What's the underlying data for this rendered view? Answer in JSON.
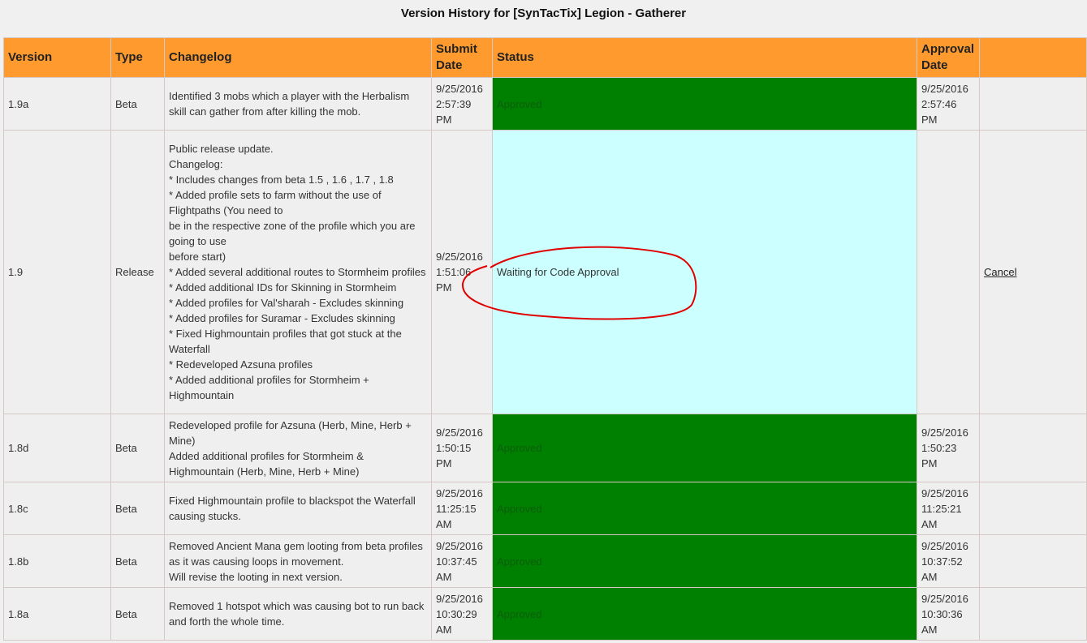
{
  "page": {
    "title": "Version History for [SynTacTix] Legion - Gatherer"
  },
  "table": {
    "headers": {
      "version": "Version",
      "type": "Type",
      "changelog": "Changelog",
      "submit_date": "Submit Date",
      "status": "Status",
      "approval_date": "Approval Date",
      "action": ""
    },
    "rows": [
      {
        "version": "1.9a",
        "type": "Beta",
        "changelog": "Identified 3 mobs which a player with the Herbalism skill can gather from after killing the mob.",
        "submit_date": "9/25/2016 2:57:39 PM",
        "status": "Approved",
        "approval_date": "9/25/2016 2:57:46 PM",
        "action": ""
      },
      {
        "version": "1.9",
        "type": "Release",
        "changelog": "Public release update.\nChangelog:\n* Includes changes from beta 1.5 , 1.6 , 1.7 , 1.8\n* Added profile sets to farm without the use of Flightpaths (You need to\nbe in the respective zone of the profile which you are going to use\nbefore start)\n* Added several additional routes to Stormheim profiles\n* Added additional IDs for Skinning in Stormheim\n* Added profiles for Val'sharah - Excludes skinning\n* Added profiles for Suramar - Excludes skinning\n* Fixed Highmountain profiles that got stuck at the Waterfall\n* Redeveloped Azsuna profiles\n* Added additional profiles for Stormheim + Highmountain",
        "submit_date": "9/25/2016 1:51:06 PM",
        "status": "Waiting for Code Approval",
        "approval_date": "",
        "action": "Cancel"
      },
      {
        "version": "1.8d",
        "type": "Beta",
        "changelog": "Redeveloped profile for Azsuna (Herb, Mine, Herb + Mine)\nAdded additional profiles for Stormheim & Highmountain (Herb, Mine, Herb + Mine)",
        "submit_date": "9/25/2016 1:50:15 PM",
        "status": "Approved",
        "approval_date": "9/25/2016 1:50:23 PM",
        "action": ""
      },
      {
        "version": "1.8c",
        "type": "Beta",
        "changelog": "Fixed Highmountain profile to blackspot the Waterfall causing stucks.",
        "submit_date": "9/25/2016 11:25:15 AM",
        "status": "Approved",
        "approval_date": "9/25/2016 11:25:21 AM",
        "action": ""
      },
      {
        "version": "1.8b",
        "type": "Beta",
        "changelog": "Removed Ancient Mana gem looting from beta profiles as it was causing loops in movement.\nWill revise the looting in next version.",
        "submit_date": "9/25/2016 10:37:45 AM",
        "status": "Approved",
        "approval_date": "9/25/2016 10:37:52 AM",
        "action": ""
      },
      {
        "version": "1.8a",
        "type": "Beta",
        "changelog": "Removed 1 hotspot which was causing bot to run back and forth the whole time.",
        "submit_date": "9/25/2016 10:30:29 AM",
        "status": "Approved",
        "approval_date": "9/25/2016 10:30:36 AM",
        "action": ""
      }
    ]
  },
  "colors": {
    "header_bg": "#ff9a2e",
    "approved_bg": "#008000",
    "waiting_bg": "#ccffff",
    "annotation_stroke": "#e00000"
  }
}
